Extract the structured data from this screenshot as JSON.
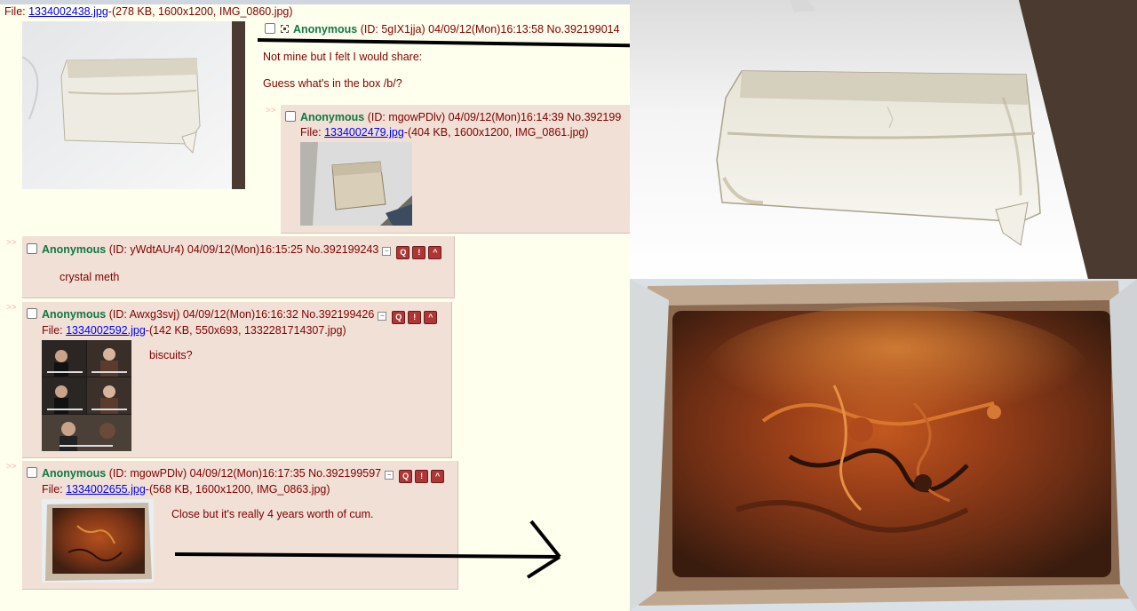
{
  "op": {
    "file_label": "File: ",
    "file_name": "1334002438.jpg",
    "file_meta": "-(278 KB, 1600x1200, IMG_0860.jpg)",
    "name": "Anonymous",
    "id_date": " (ID: 5gIX1jja) 04/09/12(Mon)16:13:58 No.392199014",
    "message_line1": "Not mine but I felt I would share:",
    "message_line2": "Guess what's in the box /b/?"
  },
  "replies": [
    {
      "arrows": ">>",
      "name": "Anonymous",
      "id_date": " (ID: mgowPDlv) 04/09/12(Mon)16:14:39 No.392199",
      "file_label": "File: ",
      "file_name": "1334002479.jpg",
      "file_meta": "-(404 KB, 1600x1200, IMG_0861.jpg)",
      "message": ""
    },
    {
      "arrows": ">>",
      "name": "Anonymous",
      "id_date": " (ID: yWdtAUr4) 04/09/12(Mon)16:15:25 No.392199243",
      "message": "crystal meth"
    },
    {
      "arrows": ">>",
      "name": "Anonymous",
      "id_date": " (ID: Awxg3svj) 04/09/12(Mon)16:16:32 No.392199426",
      "file_label": "File: ",
      "file_name": "1334002592.jpg",
      "file_meta": "-(142 KB, 550x693, 1332281714307.jpg)",
      "message": "biscuits?"
    },
    {
      "arrows": ">>",
      "name": "Anonymous",
      "id_date": " (ID: mgowPDlv) 04/09/12(Mon)16:17:35 No.392199597",
      "file_label": "File: ",
      "file_name": "1334002655.jpg",
      "file_meta": "-(568 KB, 1600x1200, IMG_0863.jpg)",
      "message": "Close but it's really 4 years worth of cum."
    }
  ],
  "buttons": {
    "minus": "−",
    "quote": "Q",
    "report": "!",
    "hide": "^"
  },
  "colors": {
    "board_bg": "#ffffee",
    "reply_bg": "#f0e0d6",
    "name_green": "#117743",
    "text_maroon": "#800000",
    "link_blue": "#0000ee"
  }
}
